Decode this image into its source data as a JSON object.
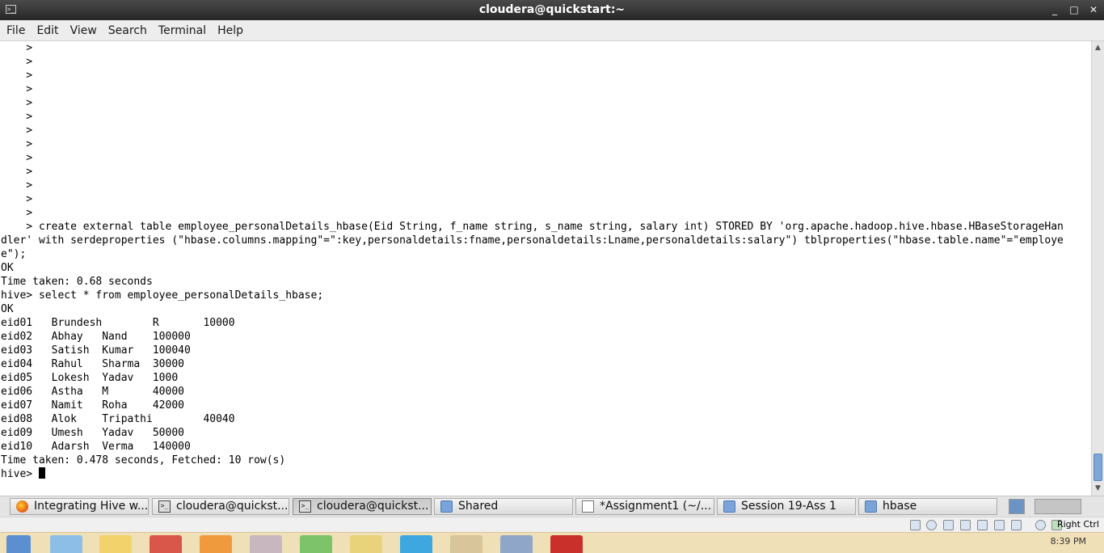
{
  "window": {
    "title": "cloudera@quickstart:~",
    "minimize_glyph": "_",
    "maximize_glyph": "□",
    "close_glyph": "✕"
  },
  "menu": {
    "file": "File",
    "edit": "Edit",
    "view": "View",
    "search": "Search",
    "terminal": "Terminal",
    "help": "Help"
  },
  "terminal": {
    "lines": [
      "    >",
      "    >",
      "    >",
      "    >",
      "    >",
      "    >",
      "    >",
      "    >",
      "    >",
      "    >",
      "    >",
      "    >",
      "    >",
      "    > create external table employee_personalDetails_hbase(Eid String, f_name string, s_name string, salary int) STORED BY 'org.apache.hadoop.hive.hbase.HBaseStorageHan",
      "dler' with serdeproperties (\"hbase.columns.mapping\"=\":key,personaldetails:fname,personaldetails:Lname,personaldetails:salary\") tblproperties(\"hbase.table.name\"=\"employe",
      "e\");",
      "OK",
      "Time taken: 0.68 seconds",
      "hive> select * from employee_personalDetails_hbase;",
      "OK",
      "eid01   Brundesh        R       10000",
      "eid02   Abhay   Nand    100000",
      "eid03   Satish  Kumar   100040",
      "eid04   Rahul   Sharma  30000",
      "eid05   Lokesh  Yadav   1000",
      "eid06   Astha   M       40000",
      "eid07   Namit   Roha    42000",
      "eid08   Alok    Tripathi        40040",
      "eid09   Umesh   Yadav   50000",
      "eid10   Adarsh  Verma   140000",
      "Time taken: 0.478 seconds, Fetched: 10 row(s)"
    ],
    "prompt": "hive> "
  },
  "taskbar": {
    "items": [
      {
        "label": "Integrating Hive w...",
        "icon": "firefox-icon"
      },
      {
        "label": "cloudera@quickst...",
        "icon": "terminal-icon"
      },
      {
        "label": "cloudera@quickst...",
        "icon": "terminal-icon"
      },
      {
        "label": "Shared",
        "icon": "folder-icon"
      },
      {
        "label": "*Assignment1 (~/...",
        "icon": "text-editor-icon"
      },
      {
        "label": "Session 19-Ass 1",
        "icon": "folder-icon"
      },
      {
        "label": "hbase",
        "icon": "folder-icon"
      }
    ]
  },
  "vbox_status": {
    "host_key": "Right Ctrl"
  },
  "host_taskbar": {
    "clock": "8:39 PM"
  },
  "colors": {
    "terminal_bg": "#ffffff",
    "terminal_fg": "#000000",
    "titlebar_bg": "#2f2f2f",
    "scroll_thumb": "#7ea7d8",
    "host_taskbar_bg": "#f0e0b8"
  }
}
